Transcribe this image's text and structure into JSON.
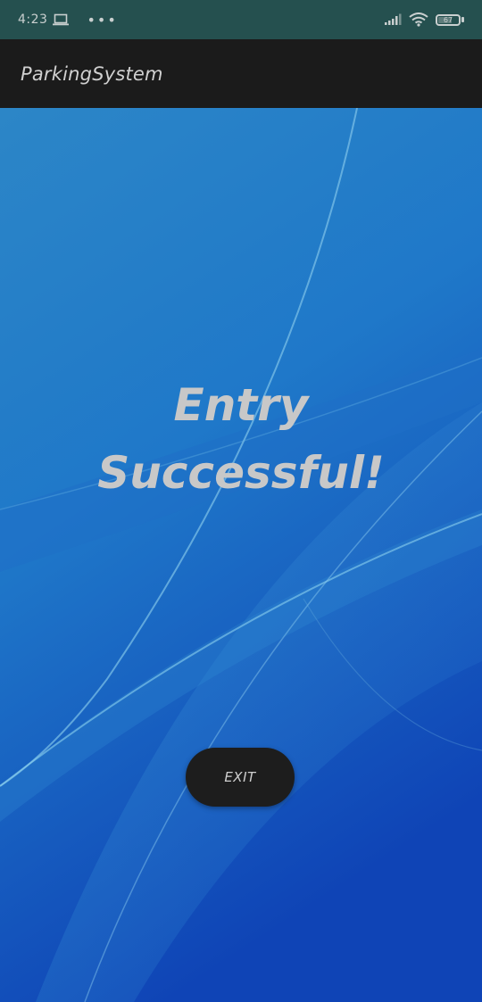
{
  "status_bar": {
    "time": "4:23",
    "more": "•••",
    "battery_level": "67"
  },
  "app_bar": {
    "title": "ParkingSystem"
  },
  "main": {
    "message_line1": "Entry",
    "message_line2": "Successful!",
    "exit_label": "EXIT"
  },
  "colors": {
    "status_bar": "#25504f",
    "app_bar": "#1b1b1b",
    "background_top": "#2a82c8",
    "background_bottom": "#1146b8",
    "button": "#1d1d1d",
    "text": "#c8c8c8"
  }
}
